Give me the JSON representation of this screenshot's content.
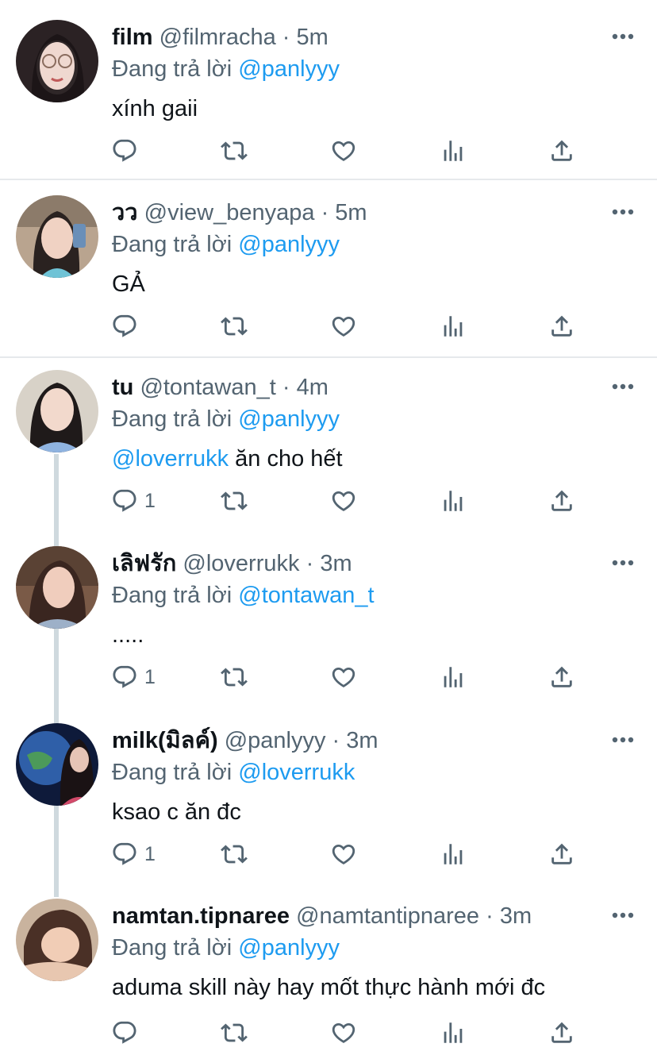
{
  "colors": {
    "link": "#1d9bf0",
    "secondary": "#536471",
    "primary_text": "#0f1419",
    "divider": "#e6e9ec",
    "thread_line": "#cfd9de"
  },
  "icons": [
    "reply-icon",
    "retweet-icon",
    "like-icon",
    "stats-icon",
    "share-icon",
    "more-icon"
  ],
  "tweets": [
    {
      "name": "film",
      "handle": "@filmracha",
      "separator": "·",
      "time": "5m",
      "replying_prefix": "Đang trả lời",
      "replying_to": "@panlyyy",
      "text_mention": "",
      "text": "xính gaii",
      "reply_count": ""
    },
    {
      "name": "วว",
      "handle": "@view_benyapa",
      "separator": "·",
      "time": "5m",
      "replying_prefix": "Đang trả lời",
      "replying_to": "@panlyyy",
      "text_mention": "",
      "text": "GẢ",
      "reply_count": ""
    },
    {
      "name": "tu",
      "handle": "@tontawan_t",
      "separator": "·",
      "time": "4m",
      "replying_prefix": "Đang trả lời",
      "replying_to": "@panlyyy",
      "text_mention": "@loverrukk",
      "text": " ăn cho hết",
      "reply_count": "1"
    },
    {
      "name": "เลิฟรัก",
      "handle": "@loverrukk",
      "separator": "·",
      "time": "3m",
      "replying_prefix": "Đang trả lời",
      "replying_to": "@tontawan_t",
      "text_mention": "",
      "text": ".....",
      "reply_count": "1"
    },
    {
      "name": "milk(มิลค์)",
      "handle": "@panlyyy",
      "separator": "·",
      "time": "3m",
      "replying_prefix": "Đang trả lời",
      "replying_to": "@loverrukk",
      "text_mention": "",
      "text": "ksao c ăn đc",
      "reply_count": "1"
    },
    {
      "name": "namtan.tipnaree",
      "handle": "@namtantipnaree",
      "separator": "·",
      "time": "3m",
      "replying_prefix": "Đang trả lời",
      "replying_to": "@panlyyy",
      "text_mention": "",
      "text": "aduma skill này hay mốt thực hành mới đc",
      "reply_count": ""
    }
  ]
}
